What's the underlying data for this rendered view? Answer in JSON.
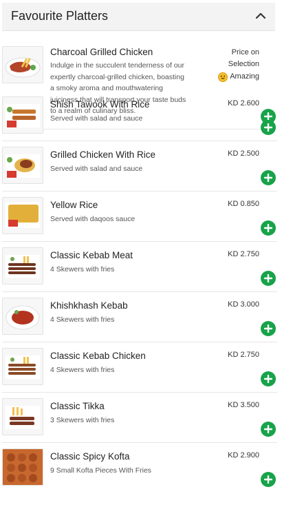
{
  "section": {
    "title": "Favourite Platters",
    "collapse_icon": "chevron-up-icon"
  },
  "colors": {
    "add_button": "#18a34a",
    "header_bg": "#f3f3f3"
  },
  "items": [
    {
      "name": "Charcoal Grilled Chicken",
      "description": "Indulge in the succulent tenderness of our expertly charcoal-grilled chicken, boasting a smoky aroma and mouthwatering juiciness that will transport your taste buds to a realm of culinary bliss.",
      "price_line1": "Price on",
      "price_line2": "Selection",
      "badge": "Amazing",
      "badge_icon": "smiley-face-icon"
    },
    {
      "name": "Shish Tawook With Rice",
      "description": "Served with salad and sauce",
      "price": "KD 2.600"
    },
    {
      "name": "Grilled Chicken With Rice",
      "description": "Served with salad and sauce",
      "price": "KD 2.500"
    },
    {
      "name": "Yellow Rice",
      "description": "Served with daqoos sauce",
      "price": "KD 0.850"
    },
    {
      "name": "Classic Kebab Meat",
      "description": "4 Skewers with fries",
      "price": "KD 2.750"
    },
    {
      "name": "Khishkhash Kebab",
      "description": "4 Skewers with fries",
      "price": "KD 3.000"
    },
    {
      "name": "Classic Kebab Chicken",
      "description": "4 Skewers with fries",
      "price": "KD 2.750"
    },
    {
      "name": "Classic Tikka",
      "description": "3 Skewers with fries",
      "price": "KD 3.500"
    },
    {
      "name": "Classic Spicy Kofta",
      "description": "9 Small Kofta Pieces With Fries",
      "price": "KD 2.900"
    }
  ]
}
